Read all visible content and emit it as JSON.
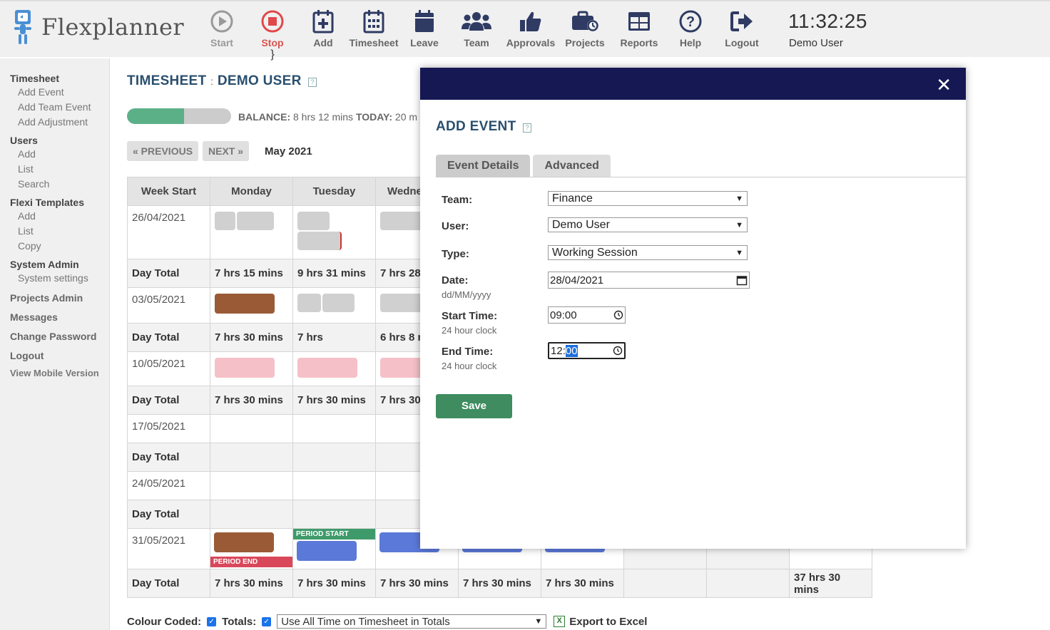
{
  "app": {
    "name": "Flexplanner"
  },
  "nav": [
    {
      "key": "start",
      "label": "Start"
    },
    {
      "key": "stop",
      "label": "Stop"
    },
    {
      "key": "add",
      "label": "Add"
    },
    {
      "key": "timesheet",
      "label": "Timesheet"
    },
    {
      "key": "leave",
      "label": "Leave"
    },
    {
      "key": "team",
      "label": "Team"
    },
    {
      "key": "approvals",
      "label": "Approvals"
    },
    {
      "key": "projects",
      "label": "Projects"
    },
    {
      "key": "reports",
      "label": "Reports"
    },
    {
      "key": "help",
      "label": "Help"
    },
    {
      "key": "logout",
      "label": "Logout"
    }
  ],
  "clock": {
    "time": "11:32:25",
    "user": "Demo User"
  },
  "sidebar": {
    "timesheet": "Timesheet",
    "add_event": "Add Event",
    "add_team_event": "Add Team Event",
    "add_adjustment": "Add Adjustment",
    "users": "Users",
    "users_add": "Add",
    "users_list": "List",
    "users_search": "Search",
    "flexi_templates": "Flexi Templates",
    "flexi_add": "Add",
    "flexi_list": "List",
    "flexi_copy": "Copy",
    "system_admin": "System Admin",
    "system_settings": "System settings",
    "projects_admin": "Projects Admin",
    "messages": "Messages",
    "change_password": "Change Password",
    "logout": "Logout",
    "mobile": "View Mobile Version"
  },
  "page": {
    "title_a": "TIMESHEET",
    "title_sep": ":",
    "title_b": "DEMO USER",
    "balance_progress": 0.55,
    "balance_label": "BALANCE:",
    "balance_value": "8 hrs 12 mins",
    "today_label": "TODAY:",
    "today_value": "20 m",
    "prev": "« PREVIOUS",
    "next": "NEXT »",
    "month": "May 2021"
  },
  "table": {
    "headers": [
      "Week Start",
      "Monday",
      "Tuesday",
      "Wedne"
    ],
    "rows": [
      {
        "week": "26/04/2021",
        "total_label": "Day Total",
        "totals": [
          "7 hrs 15 mins",
          "9 hrs 31 mins",
          "7 hrs 28"
        ]
      },
      {
        "week": "03/05/2021",
        "total_label": "Day Total",
        "totals": [
          "7 hrs 30 mins",
          "7 hrs",
          "6 hrs 8 r"
        ]
      },
      {
        "week": "10/05/2021",
        "total_label": "Day Total",
        "totals": [
          "7 hrs 30 mins",
          "7 hrs 30 mins",
          "7 hrs 30"
        ]
      },
      {
        "week": "17/05/2021",
        "total_label": "Day Total",
        "totals": [
          "",
          "",
          ""
        ]
      },
      {
        "week": "24/05/2021",
        "total_label": "Day Total",
        "totals": [
          "",
          "",
          ""
        ]
      },
      {
        "week": "31/05/2021",
        "total_label": "Day Total",
        "totals": [
          "7 hrs 30 mins",
          "7 hrs 30 mins",
          "7 hrs 30 mins",
          "7 hrs 30 mins",
          "7 hrs 30 mins",
          "",
          "",
          "37 hrs 30 mins"
        ]
      }
    ],
    "period_start": "PERIOD START",
    "period_end": "PERIOD END"
  },
  "bottom": {
    "colour_coded": "Colour Coded:",
    "totals": "Totals:",
    "totals_select": "Use All Time on Timesheet in Totals",
    "export": "Export to Excel"
  },
  "modal": {
    "title": "ADD EVENT",
    "tab_details": "Event Details",
    "tab_advanced": "Advanced",
    "team_label": "Team:",
    "team_value": "Finance",
    "user_label": "User:",
    "user_value": "Demo User",
    "type_label": "Type:",
    "type_value": "Working Session",
    "date_label": "Date:",
    "date_value": "28/04/2021",
    "date_hint": "dd/MM/yyyy",
    "start_label": "Start Time:",
    "start_value": "09:00",
    "start_hint": "24 hour clock",
    "end_label": "End Time:",
    "end_hour": "12",
    "end_colon": ":",
    "end_min": "00",
    "end_hint": "24 hour clock",
    "save": "Save"
  }
}
